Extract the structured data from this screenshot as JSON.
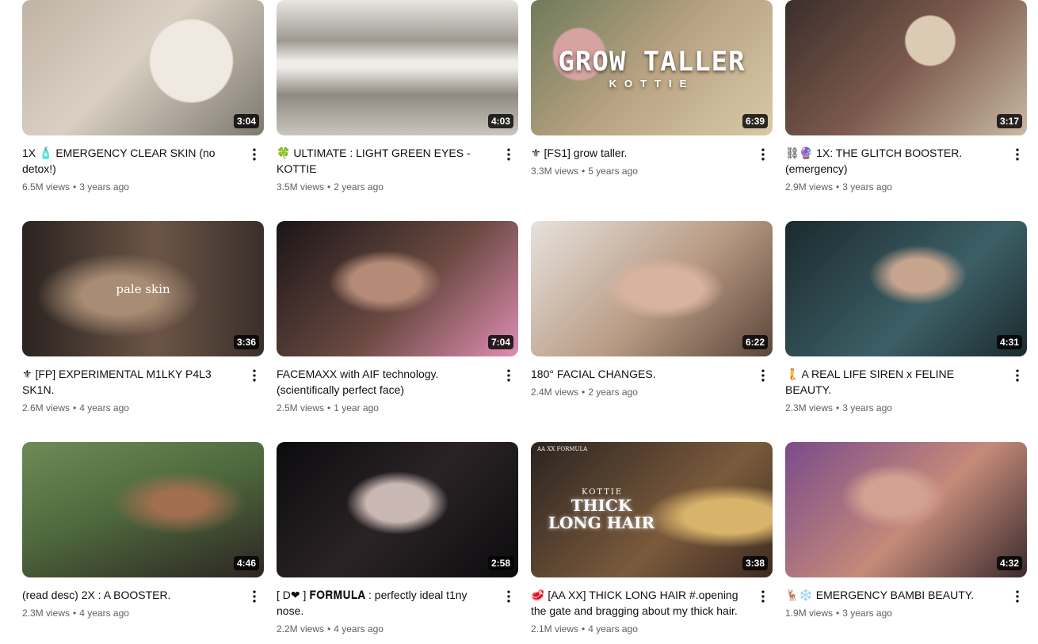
{
  "videos": [
    {
      "title": "1X 🧴 EMERGENCY CLEAR SKIN (no detox!)",
      "views": "6.5M views",
      "age": "3 years ago",
      "duration": "3:04",
      "thumb_colors": [
        "#d9cfc3",
        "#c9b59e",
        "#7f7a6e"
      ]
    },
    {
      "title": "🍀 ULTIMATE : LIGHT GREEN EYES - KOTTIE",
      "views": "3.5M views",
      "age": "2 years ago",
      "duration": "4:03",
      "thumb_colors": [
        "#c9c6bf",
        "#8f8a80",
        "#e9e6e1"
      ]
    },
    {
      "title": "⚜ [FS1] grow taller.",
      "views": "3.3M views",
      "age": "5 years ago",
      "duration": "6:39",
      "overlay": "GROW TALLER",
      "overlay_sub": "KOTTIE",
      "thumb_colors": [
        "#6e7a5a",
        "#b9a382",
        "#d8c9a7"
      ]
    },
    {
      "title": "⛓🔮 1X: THE GLITCH BOOSTER. (emergency)",
      "views": "2.9M views",
      "age": "3 years ago",
      "duration": "3:17",
      "thumb_colors": [
        "#3b2e2a",
        "#7c5a4d",
        "#c9b9a4"
      ]
    },
    {
      "title": "⚜ [FP] EXPERIMENTAL M1LKY P4L3 SK1N.",
      "views": "2.6M views",
      "age": "4 years ago",
      "duration": "3:36",
      "overlay": "pale skin",
      "thumb_colors": [
        "#2a2320",
        "#6c5547",
        "#a88c74"
      ]
    },
    {
      "title": "FACEMAXX with AIF technology. (scientifically perfect face)",
      "views": "2.5M views",
      "age": "1 year ago",
      "duration": "7:04",
      "thumb_colors": [
        "#1a1516",
        "#6b4a42",
        "#e08db3"
      ]
    },
    {
      "title": "180° FACIAL CHANGES.",
      "views": "2.4M views",
      "age": "2 years ago",
      "duration": "6:22",
      "thumb_colors": [
        "#e7e2dc",
        "#b89a84",
        "#5b4639"
      ]
    },
    {
      "title": "🧜 A REAL LIFE SIREN x FELINE BEAUTY.",
      "views": "2.3M views",
      "age": "3 years ago",
      "duration": "4:31",
      "thumb_colors": [
        "#1b2a2e",
        "#3c5f66",
        "#c7a48e"
      ]
    },
    {
      "title": "(read desc) 2X : A BOOSTER.",
      "views": "2.3M views",
      "age": "4 years ago",
      "duration": "4:46",
      "thumb_colors": [
        "#4f6b3e",
        "#2d2623",
        "#a16f4f"
      ]
    },
    {
      "title": "[ D❤ ] 𝐅𝐎𝐑𝐌𝐔𝐋𝐀 : perfectly ideal t1ny nose.",
      "views": "2.2M views",
      "age": "4 years ago",
      "duration": "2:58",
      "thumb_colors": [
        "#0b0b0d",
        "#5a4b4e",
        "#c9b7b3"
      ]
    },
    {
      "title": "🥩 [AA XX] THICK LONG HAIR #.opening the gate and bragging about my thick hair.",
      "views": "2.1M views",
      "age": "4 years ago",
      "duration": "3:38",
      "overlay": "THICK LONG HAIR",
      "overlay_sub": "KOTTIE",
      "overlay_corner": "AA XX FORMULA",
      "thumb_colors": [
        "#2b2420",
        "#7b5a3c",
        "#d8b36a"
      ]
    },
    {
      "title": "🦌❄️ EMERGENCY BAMBI BEAUTY.",
      "views": "1.9M views",
      "age": "3 years ago",
      "duration": "4:32",
      "thumb_colors": [
        "#7b4b8a",
        "#c58a7a",
        "#3a2b2d"
      ]
    }
  ]
}
